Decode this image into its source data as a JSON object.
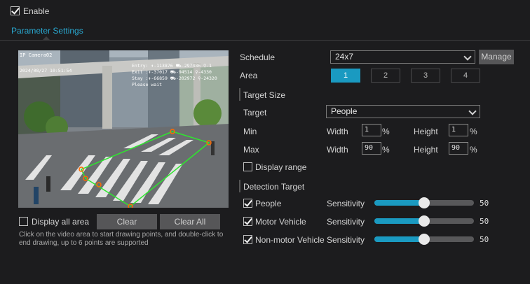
{
  "enable": {
    "label": "Enable",
    "checked": true
  },
  "tab": {
    "label": "Parameter Settings"
  },
  "video": {
    "camera_name": "IP Camera02",
    "timestamp": "2024/08/27 10:51:54",
    "overlay_lines": [
      "Entry: ↟-113876 ⛟-297486 ⚲-1",
      "Exit :↟-37017 ⛟-94514 ⚲-4330",
      "Stay :↟-66859 ⛟-202972 ⚲-24320",
      "Please wait"
    ]
  },
  "display_all_area": {
    "label": "Display all area",
    "checked": false
  },
  "buttons": {
    "clear": "Clear",
    "clear_all": "Clear All",
    "manage": "Manage"
  },
  "hint": "Click on the video area to start drawing points, and double-click to end drawing, up to 6 points are supported",
  "schedule": {
    "label": "Schedule",
    "value": "24x7"
  },
  "area": {
    "label": "Area",
    "options": [
      "1",
      "2",
      "3",
      "4"
    ],
    "active": "1"
  },
  "target_size": {
    "label": "Target Size",
    "target_label": "Target",
    "target_value": "People",
    "min_label": "Min",
    "max_label": "Max",
    "width_label": "Width",
    "height_label": "Height",
    "unit": "%",
    "min_width": "1",
    "min_height": "1",
    "max_width": "90",
    "max_height": "90"
  },
  "display_range": {
    "label": "Display range",
    "checked": false
  },
  "detection_target": {
    "label": "Detection Target",
    "sensitivity_label": "Sensitivity",
    "items": [
      {
        "label": "People",
        "checked": true,
        "value": "50"
      },
      {
        "label": "Motor Vehicle",
        "checked": true,
        "value": "50"
      },
      {
        "label": "Non-motor Vehicle",
        "checked": true,
        "value": "50"
      }
    ]
  },
  "colors": {
    "accent": "#1a9ac1",
    "background": "#1c1c1e",
    "region": "#2ee62e"
  }
}
